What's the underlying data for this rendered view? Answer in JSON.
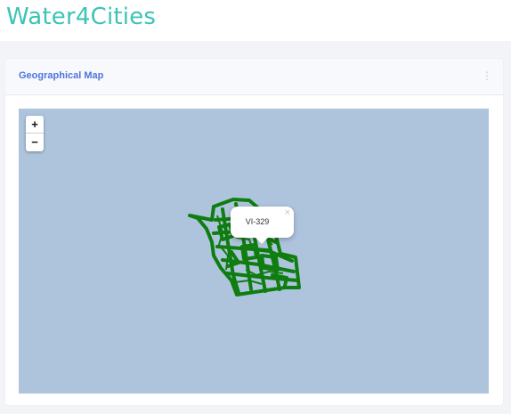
{
  "header": {
    "app_title": "Water4Cities"
  },
  "card": {
    "title": "Geographical Map",
    "menu_icon": "vertical-dots-icon"
  },
  "map": {
    "zoom_in_label": "+",
    "zoom_out_label": "−",
    "network_color": "#0f7d0f",
    "background_color": "#aec4dd",
    "popup": {
      "text": "VI-329",
      "close_label": "×"
    }
  }
}
